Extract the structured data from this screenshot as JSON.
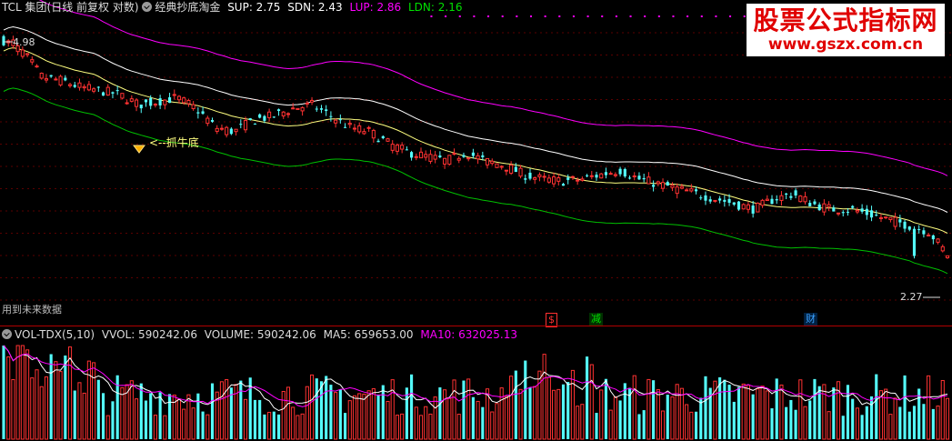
{
  "price_panel": {
    "stock_name": "TCL 集团",
    "period_info": "(日线 前复权 对数)",
    "indicator_name": "经典抄底淘金",
    "sup": "SUP: 2.75",
    "sdn": "SDN: 2.43",
    "lup": "LUP: 2.86",
    "ldn": "LDN: 2.16",
    "high_label": "4.98",
    "low_label": "2.27",
    "signal_label": "<--抓牛底",
    "future_data_note": "用到未来数据",
    "events": [
      {
        "label": "$",
        "color": "#ff3030"
      },
      {
        "label": "减",
        "color": "#00e000"
      },
      {
        "label": "财",
        "color": "#3aa0ff"
      }
    ]
  },
  "volume_panel": {
    "indicator_name": "VOL-TDX(5,10)",
    "vvol": "VVOL: 590242.06",
    "volume": "VOLUME: 590242.06",
    "ma5": "MA5: 659653.00",
    "ma10": "MA10: 632025.13"
  },
  "watermark": {
    "title": "股票公式指标网",
    "url": "www.gszx.com.cn"
  },
  "colors": {
    "up": "#ff3232",
    "down": "#54fcfc",
    "upper_band": "#ff00ff",
    "middle_band": "#ffff80",
    "lower_band": "#00c000",
    "mid_line": "#ffffff",
    "ma5": "#ffffff",
    "ma10": "#ff00ff"
  },
  "chart_data": [
    {
      "type": "candlestick",
      "title": "TCL 集团 (日线 前复权 对数) 经典抄底淘金",
      "scale": "log",
      "visible_high": 4.98,
      "visible_low": 2.27,
      "last_values": {
        "SUP": 2.75,
        "SDN": 2.43,
        "LUP": 2.86,
        "LDN": 2.16
      },
      "price_path": [
        4.9,
        4.7,
        4.3,
        4.25,
        4.15,
        4.1,
        4.05,
        3.9,
        3.95,
        4.0,
        3.85,
        3.6,
        3.55,
        3.7,
        3.75,
        3.85,
        3.9,
        3.75,
        3.6,
        3.55,
        3.4,
        3.3,
        3.25,
        3.2,
        3.3,
        3.2,
        3.15,
        3.05,
        3.0,
        2.98,
        3.0,
        3.05,
        3.1,
        3.0,
        2.95,
        2.9,
        2.85,
        2.8,
        2.75,
        2.7,
        2.8,
        2.85,
        2.75,
        2.7,
        2.7,
        2.65,
        2.6,
        2.55,
        2.5,
        2.3
      ]
    },
    {
      "type": "bar",
      "title": "VOL-TDX(5,10)",
      "last_values": {
        "VVOL": 590242.06,
        "VOLUME": 590242.06,
        "MA5": 659653.0,
        "MA10": 632025.13
      }
    }
  ]
}
